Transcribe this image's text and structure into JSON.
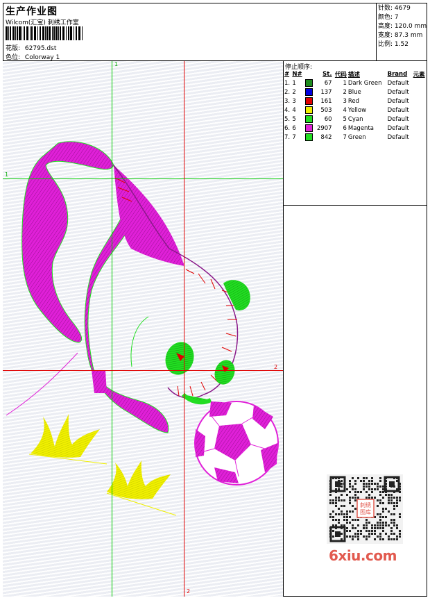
{
  "header": {
    "title": "生产作业图",
    "company": "Wilcom(汇宝) 刺绣工作室",
    "design_label": "花版:",
    "design_value": "62795.dst",
    "colorway_label": "色位:",
    "colorway_value": "Colorway 1"
  },
  "stats": [
    {
      "label": "针数:",
      "value": "4679"
    },
    {
      "label": "颜色:",
      "value": "7"
    },
    {
      "label": "高度:",
      "value": "120.0 mm"
    },
    {
      "label": "宽度:",
      "value": "87.3 mm"
    },
    {
      "label": "比例:",
      "value": "1.52"
    }
  ],
  "thread_panel": {
    "title": "停止顺序:",
    "headers": [
      "#",
      "N#",
      "St.",
      "代码",
      "描述",
      "Brand",
      "元素"
    ],
    "rows": [
      {
        "order": "1.",
        "n": "1",
        "color": "#1e8c1e",
        "stitches": "67",
        "code": "1",
        "desc": "Dark Green",
        "brand": "Default"
      },
      {
        "order": "2.",
        "n": "2",
        "color": "#0000e0",
        "stitches": "137",
        "code": "2",
        "desc": "Blue",
        "brand": "Default"
      },
      {
        "order": "3.",
        "n": "3",
        "color": "#e00000",
        "stitches": "161",
        "code": "3",
        "desc": "Red",
        "brand": "Default"
      },
      {
        "order": "4.",
        "n": "4",
        "color": "#f0f000",
        "stitches": "503",
        "code": "4",
        "desc": "Yellow",
        "brand": "Default"
      },
      {
        "order": "5.",
        "n": "5",
        "color": "#22dd22",
        "stitches": "60",
        "code": "5",
        "desc": "Cyan",
        "brand": "Default"
      },
      {
        "order": "6.",
        "n": "6",
        "color": "#e020d8",
        "stitches": "2907",
        "code": "6",
        "desc": "Magenta",
        "brand": "Default"
      },
      {
        "order": "7.",
        "n": "7",
        "color": "#22dd22",
        "stitches": "842",
        "code": "7",
        "desc": "Green",
        "brand": "Default"
      }
    ]
  },
  "guides": {
    "green_label_top": "1",
    "green_label_left": "1",
    "red_label_right": "2",
    "red_label_bottom": "2"
  },
  "watermark": {
    "qr_stamp": "刺绣图库",
    "logo": "6xiu.com"
  },
  "colors": {
    "magenta": "#e020d8",
    "green": "#22dd22",
    "yellow": "#f0f000",
    "red": "#e00000",
    "guide_green": "#00cc00",
    "guide_red": "#e00000",
    "logo": "#e25a4f"
  }
}
